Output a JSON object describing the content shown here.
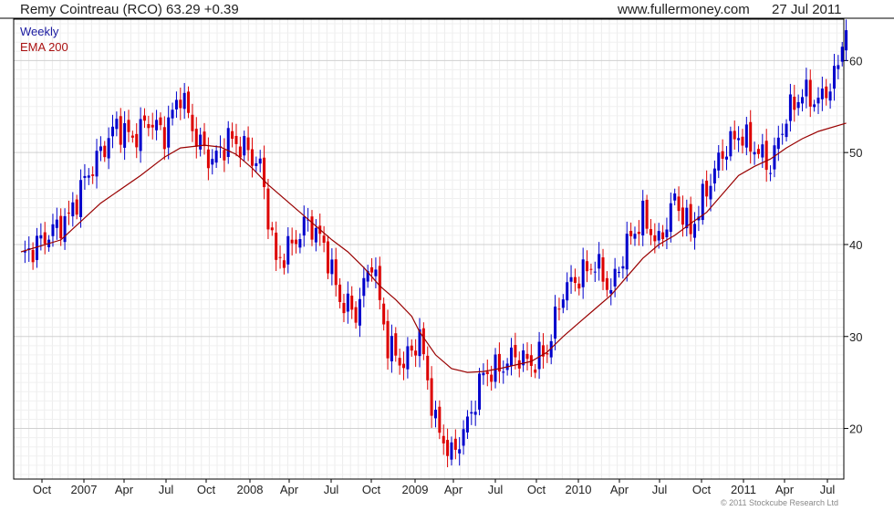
{
  "header": {
    "title": "Remy Cointreau (RCO) 63.29 +0.39",
    "site": "www.fullermoney.com",
    "date": "27 Jul 2011"
  },
  "footer": {
    "copyright": "© 2011 Stockcube Research Ltd"
  },
  "colors": {
    "up": "#0000cc",
    "down": "#dd0000",
    "ema": "#990000",
    "grid": "#d0d0d0",
    "frame": "#000000"
  },
  "chart_data": {
    "type": "candlestick",
    "legend": [
      {
        "label": "Weekly",
        "color": "#1a1aa0"
      },
      {
        "label": "EMA 200",
        "color": "#aa1111"
      }
    ],
    "ylim": [
      14.5,
      64.5
    ],
    "y_ticks": [
      "20",
      "30",
      "40",
      "50",
      "60"
    ],
    "x_ticks": [
      "Oct",
      "2007",
      "Apr",
      "Jul",
      "Oct",
      "2008",
      "Apr",
      "Jul",
      "Oct",
      "2009",
      "Apr",
      "Jul",
      "Oct",
      "2010",
      "Apr",
      "Jul",
      "Oct",
      "2011",
      "Apr",
      "Jul"
    ],
    "anchors": [
      [
        0,
        38.5
      ],
      [
        4,
        40
      ],
      [
        8,
        41.5
      ],
      [
        12,
        43
      ],
      [
        16,
        47
      ],
      [
        20,
        50
      ],
      [
        24,
        53
      ],
      [
        28,
        51.5
      ],
      [
        32,
        53.5
      ],
      [
        36,
        52
      ],
      [
        40,
        56.5
      ],
      [
        44,
        51.5
      ],
      [
        48,
        49
      ],
      [
        52,
        51.5
      ],
      [
        56,
        50.5
      ],
      [
        60,
        48.5
      ],
      [
        64,
        38
      ],
      [
        68,
        40
      ],
      [
        72,
        42.5
      ],
      [
        76,
        40
      ],
      [
        80,
        34
      ],
      [
        84,
        32.5
      ],
      [
        88,
        38.5
      ],
      [
        92,
        29
      ],
      [
        96,
        27
      ],
      [
        100,
        30
      ],
      [
        104,
        20.5
      ],
      [
        108,
        17
      ],
      [
        112,
        20.5
      ],
      [
        116,
        26
      ],
      [
        120,
        26.5
      ],
      [
        124,
        28
      ],
      [
        128,
        27
      ],
      [
        132,
        28.5
      ],
      [
        136,
        35
      ],
      [
        140,
        36.5
      ],
      [
        144,
        38
      ],
      [
        148,
        35
      ],
      [
        152,
        40
      ],
      [
        156,
        43
      ],
      [
        160,
        40
      ],
      [
        164,
        45
      ],
      [
        168,
        41.5
      ],
      [
        172,
        46
      ],
      [
        176,
        50
      ],
      [
        180,
        52
      ],
      [
        184,
        50.5
      ],
      [
        188,
        48.5
      ],
      [
        192,
        54
      ],
      [
        196,
        56.5
      ],
      [
        200,
        55.5
      ],
      [
        204,
        58
      ]
    ],
    "last_weeks": [
      [
        205,
        59.5
      ],
      [
        206,
        61.5
      ],
      [
        207,
        63.3
      ]
    ],
    "ema": [
      [
        0,
        39.2
      ],
      [
        10,
        40.5
      ],
      [
        20,
        44.5
      ],
      [
        30,
        47.5
      ],
      [
        36,
        49.5
      ],
      [
        40,
        50.5
      ],
      [
        46,
        50.8
      ],
      [
        50,
        50.6
      ],
      [
        54,
        49.8
      ],
      [
        58,
        48.3
      ],
      [
        62,
        46.5
      ],
      [
        66,
        45
      ],
      [
        70,
        43.5
      ],
      [
        74,
        42
      ],
      [
        78,
        40.5
      ],
      [
        82,
        39.2
      ],
      [
        86,
        37.5
      ],
      [
        90,
        35.5
      ],
      [
        94,
        34
      ],
      [
        98,
        32.2
      ],
      [
        100,
        30.5
      ],
      [
        104,
        28
      ],
      [
        108,
        26.5
      ],
      [
        112,
        26.1
      ],
      [
        116,
        26.2
      ],
      [
        120,
        26.5
      ],
      [
        124,
        26.9
      ],
      [
        128,
        27.3
      ],
      [
        132,
        28.3
      ],
      [
        136,
        30
      ],
      [
        140,
        31.5
      ],
      [
        144,
        33
      ],
      [
        148,
        34.5
      ],
      [
        152,
        36.5
      ],
      [
        156,
        38.5
      ],
      [
        160,
        40
      ],
      [
        164,
        41
      ],
      [
        168,
        42.3
      ],
      [
        172,
        43.5
      ],
      [
        176,
        45.5
      ],
      [
        180,
        47.5
      ],
      [
        184,
        48.5
      ],
      [
        188,
        49.3
      ],
      [
        192,
        50.5
      ],
      [
        196,
        51.5
      ],
      [
        200,
        52.3
      ],
      [
        207,
        53.2
      ]
    ],
    "grid": true
  }
}
